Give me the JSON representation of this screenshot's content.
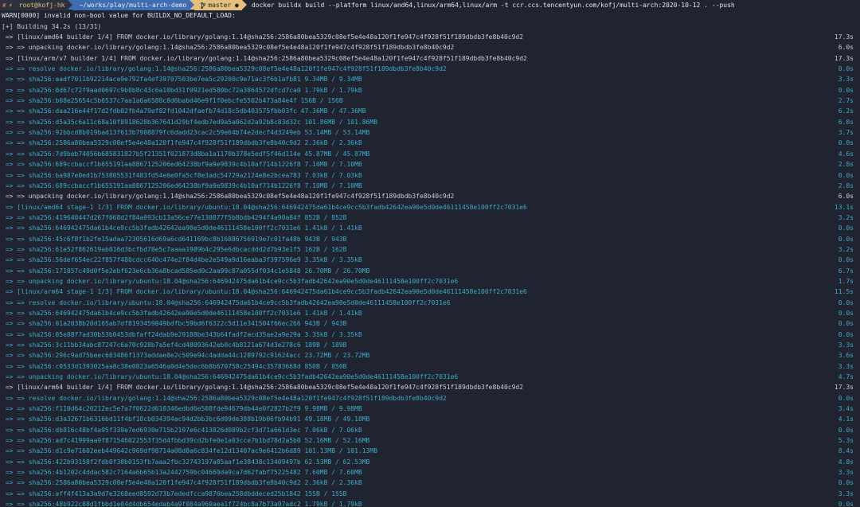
{
  "prompt": {
    "status_icons": [
      "✘",
      "⚡"
    ],
    "user": "root@kofj-hk",
    "path": "~/works/play/multi-arch-demo",
    "git_icon": "branch-icon",
    "branch": "master ●",
    "command": "docker buildx build --platform linux/and64,linux/arm64,linux/arm -t ccr.ccs.tencentyun.com/kofj/multi-arch:2020-10-12 . --push"
  },
  "warn": "WARN[0000] invalid non-bool value for BUILDX_NO_DEFAULT_LOAD:",
  "building": "[+] Building 34.2s (13/31)",
  "lines": [
    {
      "t": "step",
      "text": " => [linux/amd64 builder 1/4] FROM docker.io/library/golang:1.14@sha256:2586a80bea5329c08ef5e4e48a120f1fe947c4f928f51f189dbdb3fe8b40c9d2",
      "time": "17.3s"
    },
    {
      "t": "step",
      "text": " => => unpacking docker.io/library/golang:1.14@sha256:2586a80bea5329c08ef5e4e48a120f1fe947c4f928f51f189dbdb3fe8b40c9d2",
      "time": "6.0s"
    },
    {
      "t": "step",
      "text": " => [linux/arm/v7 builder 1/4] FROM docker.io/library/golang:1.14@sha256:2586a80bea5329c08ef5e4e48a120f1fe947c4f928f51f189dbdb3fe8b40c9d2",
      "time": "17.3s"
    },
    {
      "t": "sub",
      "text": " => => resolve docker.io/library/golang:1.14@sha256:2586a80bea5329c08ef5e4e48a120f1fe947c4f928f51f189dbdb3fe8b40c9d2",
      "time": "0.0s"
    },
    {
      "t": "sub",
      "text": " => => sha256:aadf7011b92214ace9e792fa4ef39707503be7ea5c29200c9e71ac3f6b1afb81 9.34MB / 9.34MB",
      "time": "3.3s"
    },
    {
      "t": "sub",
      "text": " => => sha256:0d67c72f9aad0697c9b0b8c43c6a10bd31f0921ed580bc72a3864572dfcd7ca0 1.79kB / 1.79kB",
      "time": "0.0s"
    },
    {
      "t": "sub",
      "text": " => => sha256:b08e25654c5b6537c7aa1a6a6588c8d6babd46e9f1f0ebcfe5502b473a84e4f 156B / 156B",
      "time": "2.7s"
    },
    {
      "t": "sub",
      "text": " => => sha256:daa216e44f17d2fdb02fb4a79ef82fd1042dfaefb74d18c5db403575fbb03fc 47.36MB / 47.36MB",
      "time": "6.2s"
    },
    {
      "t": "sub",
      "text": " => => sha256:d5a35c6a11c68a10f8918628b367641d29bf4edb7ed9a5a062d2a92b8c83d32c 101.86MB / 101.86MB",
      "time": "6.8s"
    },
    {
      "t": "sub",
      "text": " => => sha256:92bbcd8b019bad13f613b7988879fc6dadd23cac2c59e64b74e2decf4d3249eb 53.14MB / 53.14MB",
      "time": "3.7s"
    },
    {
      "t": "sub",
      "text": " => => sha256:2586a80bea5329c08ef5e4e48a120f1fe947c4f928f51f189dbdb3fe8b40c9d2 2.36kB / 2.36kB",
      "time": "0.0s"
    },
    {
      "t": "sub",
      "text": " => => sha256:7d9beb74056b685831827b5f21351f021873d8ba1a1170b378e5edf5f46d114e 45.87MB / 45.87MB",
      "time": "4.6s"
    },
    {
      "t": "sub",
      "text": " => => sha256:689ccbaccf1b655191aa8867125206ed64238bf9a9e9839c4b10af714b1226f8 7.10MB / 7.10MB",
      "time": "2.8s"
    },
    {
      "t": "sub",
      "text": " => => sha256:ba987e0ed1b753805531f483fd54e6e0fa5cf8e3adc54729a2124e8e2bcea783 7.03kB / 7.03kB",
      "time": "0.0s"
    },
    {
      "t": "sub",
      "text": " => => sha256:689ccbaccf1b655191aa8867125206ed64238bf9a9e9839c4b10af714b1226f8 7.10MB / 7.10MB",
      "time": "2.8s"
    },
    {
      "t": "step",
      "text": " => => unpacking docker.io/library/golang:1.14@sha256:2586a80bea5329c08ef5e4e48a120f1fe947c4f928f51f189dbdb3fe8b40c9d2",
      "time": "6.0s"
    },
    {
      "t": "sub",
      "text": " => [linux/amd64 stage-1 1/3] FROM docker.io/library/ubuntu:18.04@sha256:646942475da61b4ce9cc5b3fadb42642ea90e5d0de46111458e100ff2c7031e6",
      "time": "13.1s"
    },
    {
      "t": "sub",
      "text": " => => sha256:419640447d267f068d2f84a093cb13a56ce77e130877f5b8bdb4294f4a90a84f 852B / 852B",
      "time": "3.2s"
    },
    {
      "t": "sub",
      "text": " => => sha256:646942475da61b4ce9cc5b3fadb42642ea90e5d0de46111458e100ff2c7031e6 1.41kB / 1.41kB",
      "time": "0.0s"
    },
    {
      "t": "sub",
      "text": " => => sha256:45c6f8f1b2fe15adaa72305616d69a6cd641169bc8b16886756919e7c01fa48b 943B / 943B",
      "time": "0.0s"
    },
    {
      "t": "sub",
      "text": " => => sha256:61e52f862619ab016d3bcfbd78e5c7aaaa1989b4c295e6dbcacddd2d7b93e1f5 162B / 162B",
      "time": "3.2s"
    },
    {
      "t": "sub",
      "text": " => => sha256:56def654ec22f857f480cdcc640c474e2f84d4be2e549a9d16eaba3f397596e9 3.35kB / 3.35kB",
      "time": "0.0s"
    },
    {
      "t": "sub",
      "text": " => => sha256:171857c49d0f5e2ebf623e6cb36a8bcad585ed0c2aa99c87a055df034c1e5848 26.70MB / 26.70MB",
      "time": "6.7s"
    },
    {
      "t": "sub",
      "text": " => => unpacking docker.io/library/ubuntu:18.04@sha256:646942475da61b4ce9cc5b3fadb42642ea90e5d0de46111458e100ff2c7031e6",
      "time": "1.7s"
    },
    {
      "t": "sub",
      "text": " => [linux/arm64 stage-1 1/3] FROM docker.io/library/ubuntu:18.04@sha256:646942475da61b4ce9cc5b3fadb42642ea90e5d0de46111458e100ff2c7031e6",
      "time": "11.5s"
    },
    {
      "t": "sub",
      "text": " => => resolve docker.io/library/ubuntu:18.04@sha256:646942475da61b4ce9cc5b3fadb42642ea90e5d0de46111458e100ff2c7031e6",
      "time": "0.0s"
    },
    {
      "t": "sub",
      "text": " => => sha256:646942475da61b4ce9cc5b3fadb42642ea90e5d0de46111458e100ff2c7031e6 1.41kB / 1.41kB",
      "time": "0.0s"
    },
    {
      "t": "sub",
      "text": " => => sha256:01a2038b20d165ab7df8193459849bdfbc59bd6f6322c5d11e341504f66ec266 943B / 943B",
      "time": "0.0s"
    },
    {
      "t": "sub",
      "text": " => => sha256:05e88f7ad30b53b0453dbfaff24dab9e29188be343b64fadf2acd35ae2a9e29a 3.35kB / 3.35kB",
      "time": "0.0s"
    },
    {
      "t": "sub",
      "text": " => => sha256:3c11bb34abc87247c6a70c928b7a5ef4cd48093642eb0c4b8121a674d3e278c6 189B / 189B",
      "time": "3.3s"
    },
    {
      "t": "sub",
      "text": " => => sha256:296c9ad75beec603486f1373addae8e2c509e94c4adda44c1289792c91624acc 23.72MB / 23.72MB",
      "time": "3.6s"
    },
    {
      "t": "sub",
      "text": " => => sha256:c0533d1393025aa8c38e0823a6546a0d4e5dec6b8b670758c25494c35783668d 850B / 850B",
      "time": "3.3s"
    },
    {
      "t": "sub",
      "text": " => => unpacking docker.io/library/ubuntu:18.04@sha256:646942475da61b4ce9cc5b3fadb42642ea90e5d0de46111458e100ff2c7031e6",
      "time": "4.7s"
    },
    {
      "t": "step",
      "text": " => [linux/arm64 builder 1/4] FROM docker.io/library/golang:1.14@sha256:2586a80bea5329c08ef5e4e48a120f1fe947c4f928f51f189dbdb3fe8b40c9d2",
      "time": "17.3s"
    },
    {
      "t": "sub",
      "text": " => => resolve docker.io/library/golang:1.14@sha256:2586a80bea5329c08ef5e4e48a120f1fe947c4f928f51f189dbdb3fe8b40c9d2",
      "time": "0.0s"
    },
    {
      "t": "sub",
      "text": " => => sha256:f110d64c20212ec5e7a7f0622d610346edbd6e508fde94679db44e0f2827b2f9 9.98MB / 9.98MB",
      "time": "3.4s"
    },
    {
      "t": "sub",
      "text": " => => sha256:d3a32671b6316bd11f4bf18cb034394ac94d2bb3bc6d09de388b19b06fb94b91 49.18MB / 49.18MB",
      "time": "4.1s"
    },
    {
      "t": "sub",
      "text": " => => sha256:db816c48bf4a95f339e7ed6930e715b2197e6c413826d089b2cf3d71a661d3ec 7.06kB / 7.06kB",
      "time": "0.0s"
    },
    {
      "t": "sub",
      "text": " => => sha256:ad7c41999aa9f871546022553f35d4fbbd39cd2bfe0e1a03cce7b1bd78d2a5b0 52.16MB / 52.16MB",
      "time": "5.3s"
    },
    {
      "t": "sub",
      "text": " => => sha256:d1c9e71602eeb449642c969df98714a08d8a6c834fe12d13407ac9e6412b6d89 101.13MB / 101.13MB",
      "time": "8.4s"
    },
    {
      "t": "sub",
      "text": " => => sha256:422b93158f2fdb0f38b0153fb7aaa2fbc32743197a85aaf1e38438c13409497b 62.53MB / 62.53MB",
      "time": "4.8s"
    },
    {
      "t": "sub",
      "text": " => => sha256:4b1202c4ddac582c7164a6b65b13a2442759bc04660da9ca7d62fabf75225482 7.60MB / 7.60MB",
      "time": "3.3s"
    },
    {
      "t": "sub",
      "text": " => => sha256:2586a80bea5329c08ef5e4e48a120f1fe947c4f928f51f189dbdb3fe8b40c9d2 2.36kB / 2.36kB",
      "time": "0.0s"
    },
    {
      "t": "sub",
      "text": " => => sha256:aff4f413a3a9d7e3268eed8592d73b7ededfcca9876bea258dbddeced25b1842 155B / 155B",
      "time": "3.3s"
    },
    {
      "t": "sub",
      "text": " => => sha256:48b922c88d1fbbd1e04d4db654edab4a9f084a960aea1f724bc8a7b73a97adc2 1.79kB / 1.79kB",
      "time": "0.0s"
    }
  ]
}
